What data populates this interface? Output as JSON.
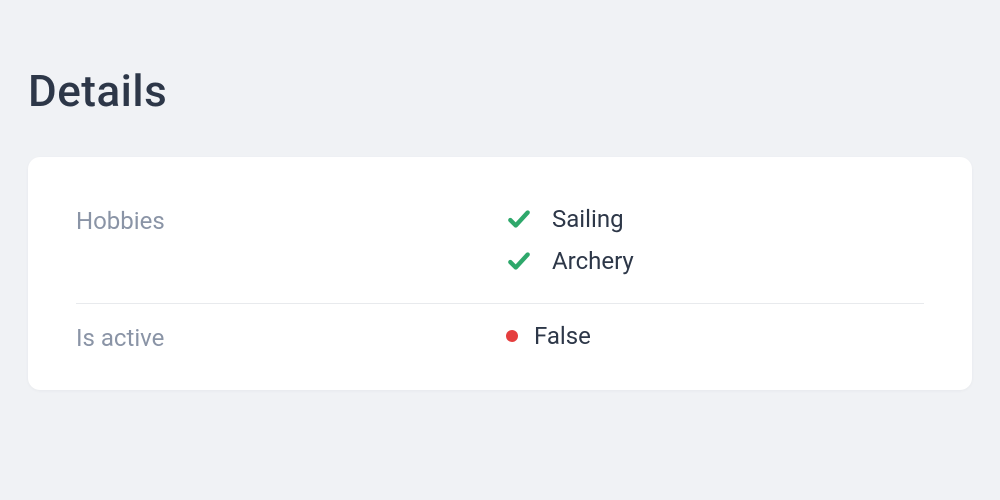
{
  "page": {
    "title": "Details"
  },
  "fields": {
    "hobbies": {
      "label": "Hobbies",
      "items": [
        "Sailing",
        "Archery"
      ]
    },
    "is_active": {
      "label": "Is active",
      "value": "False",
      "status_color": "#e53e3e"
    }
  }
}
